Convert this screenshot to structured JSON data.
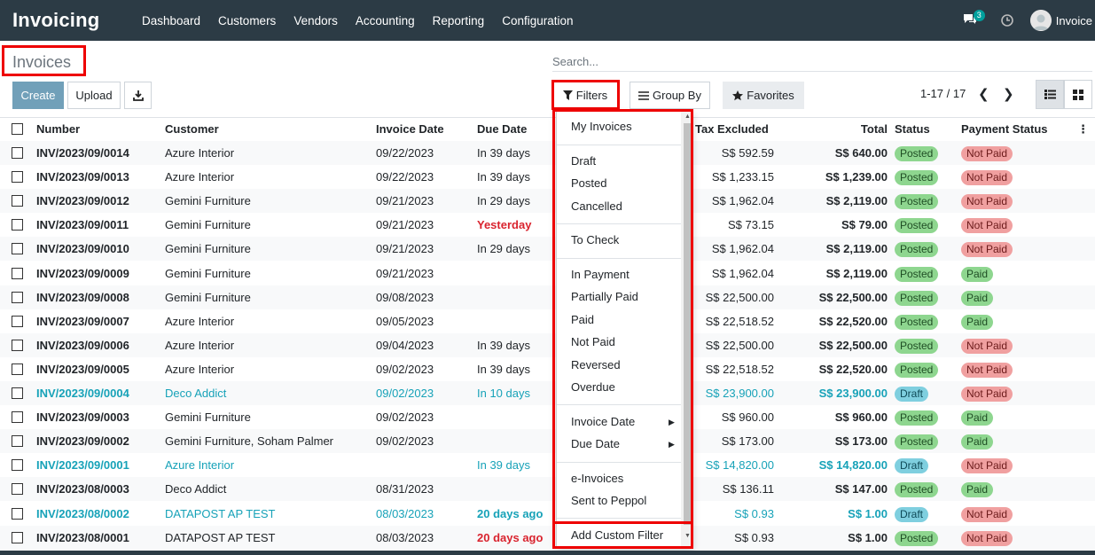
{
  "app": {
    "brand": "Invoicing",
    "user": "Invoice",
    "chat_count": "3"
  },
  "menu": [
    "Dashboard",
    "Customers",
    "Vendors",
    "Accounting",
    "Reporting",
    "Configuration"
  ],
  "page": {
    "title": "Invoices",
    "search_placeholder": "Search...",
    "pager": "1-17 / 17"
  },
  "buttons": {
    "create": "Create",
    "upload": "Upload",
    "filters": "Filters",
    "group_by": "Group By",
    "favorites": "Favorites"
  },
  "columns": {
    "number": "Number",
    "customer": "Customer",
    "invoice_date": "Invoice Date",
    "due_date": "Due Date",
    "tax_excluded": "Tax Excluded",
    "total": "Total",
    "status": "Status",
    "payment_status": "Payment Status"
  },
  "rows": [
    {
      "number": "INV/2023/09/0014",
      "customer": "Azure Interior",
      "invoice_date": "09/22/2023",
      "due_date": "In 39 days",
      "tax_excluded": "S$ 592.59",
      "total": "S$ 640.00",
      "status": "Posted",
      "payment": "Not Paid"
    },
    {
      "number": "INV/2023/09/0013",
      "customer": "Azure Interior",
      "invoice_date": "09/22/2023",
      "due_date": "In 39 days",
      "tax_excluded": "S$ 1,233.15",
      "total": "S$ 1,239.00",
      "status": "Posted",
      "payment": "Not Paid"
    },
    {
      "number": "INV/2023/09/0012",
      "customer": "Gemini Furniture",
      "invoice_date": "09/21/2023",
      "due_date": "In 29 days",
      "tax_excluded": "S$ 1,962.04",
      "total": "S$ 2,119.00",
      "status": "Posted",
      "payment": "Not Paid"
    },
    {
      "number": "INV/2023/09/0011",
      "customer": "Gemini Furniture",
      "invoice_date": "09/21/2023",
      "due_date": "Yesterday",
      "tax_excluded": "S$ 73.15",
      "total": "S$ 79.00",
      "status": "Posted",
      "payment": "Not Paid"
    },
    {
      "number": "INV/2023/09/0010",
      "customer": "Gemini Furniture",
      "invoice_date": "09/21/2023",
      "due_date": "In 29 days",
      "tax_excluded": "S$ 1,962.04",
      "total": "S$ 2,119.00",
      "status": "Posted",
      "payment": "Not Paid"
    },
    {
      "number": "INV/2023/09/0009",
      "customer": "Gemini Furniture",
      "invoice_date": "09/21/2023",
      "due_date": "",
      "tax_excluded": "S$ 1,962.04",
      "total": "S$ 2,119.00",
      "status": "Posted",
      "payment": "Paid"
    },
    {
      "number": "INV/2023/09/0008",
      "customer": "Gemini Furniture",
      "invoice_date": "09/08/2023",
      "due_date": "",
      "tax_excluded": "S$ 22,500.00",
      "total": "S$ 22,500.00",
      "status": "Posted",
      "payment": "Paid"
    },
    {
      "number": "INV/2023/09/0007",
      "customer": "Azure Interior",
      "invoice_date": "09/05/2023",
      "due_date": "",
      "tax_excluded": "S$ 22,518.52",
      "total": "S$ 22,520.00",
      "status": "Posted",
      "payment": "Paid"
    },
    {
      "number": "INV/2023/09/0006",
      "customer": "Azure Interior",
      "invoice_date": "09/04/2023",
      "due_date": "In 39 days",
      "tax_excluded": "S$ 22,500.00",
      "total": "S$ 22,500.00",
      "status": "Posted",
      "payment": "Not Paid"
    },
    {
      "number": "INV/2023/09/0005",
      "customer": "Azure Interior",
      "invoice_date": "09/02/2023",
      "due_date": "In 39 days",
      "tax_excluded": "S$ 22,518.52",
      "total": "S$ 22,520.00",
      "status": "Posted",
      "payment": "Not Paid"
    },
    {
      "number": "INV/2023/09/0004",
      "customer": "Deco Addict",
      "invoice_date": "09/02/2023",
      "due_date": "In 10 days",
      "tax_excluded": "S$ 23,900.00",
      "total": "S$ 23,900.00",
      "status": "Draft",
      "payment": "Not Paid"
    },
    {
      "number": "INV/2023/09/0003",
      "customer": "Gemini Furniture",
      "invoice_date": "09/02/2023",
      "due_date": "",
      "tax_excluded": "S$ 960.00",
      "total": "S$ 960.00",
      "status": "Posted",
      "payment": "Paid"
    },
    {
      "number": "INV/2023/09/0002",
      "customer": "Gemini Furniture, Soham Palmer",
      "invoice_date": "09/02/2023",
      "due_date": "",
      "tax_excluded": "S$ 173.00",
      "total": "S$ 173.00",
      "status": "Posted",
      "payment": "Paid"
    },
    {
      "number": "INV/2023/09/0001",
      "customer": "Azure Interior",
      "invoice_date": "",
      "due_date": "In 39 days",
      "tax_excluded": "S$ 14,820.00",
      "total": "S$ 14,820.00",
      "status": "Draft",
      "payment": "Not Paid"
    },
    {
      "number": "INV/2023/08/0003",
      "customer": "Deco Addict",
      "invoice_date": "08/31/2023",
      "due_date": "",
      "tax_excluded": "S$ 136.11",
      "total": "S$ 147.00",
      "status": "Posted",
      "payment": "Paid"
    },
    {
      "number": "INV/2023/08/0002",
      "customer": "DATAPOST AP TEST",
      "invoice_date": "08/03/2023",
      "due_date": "20 days ago",
      "tax_excluded": "S$ 0.93",
      "total": "S$ 1.00",
      "status": "Draft",
      "payment": "Not Paid"
    },
    {
      "number": "INV/2023/08/0001",
      "customer": "DATAPOST AP TEST",
      "invoice_date": "08/03/2023",
      "due_date": "20 days ago",
      "tax_excluded": "S$ 0.93",
      "total": "S$ 1.00",
      "status": "Posted",
      "payment": "Not Paid"
    }
  ],
  "filters_menu": [
    {
      "label": "My Invoices"
    },
    {
      "label": "Draft"
    },
    {
      "label": "Posted"
    },
    {
      "label": "Cancelled"
    },
    {
      "label": "To Check"
    },
    {
      "label": "In Payment"
    },
    {
      "label": "Partially Paid"
    },
    {
      "label": "Paid"
    },
    {
      "label": "Not Paid"
    },
    {
      "label": "Reversed"
    },
    {
      "label": "Overdue"
    },
    {
      "label": "Invoice Date",
      "submenu": true
    },
    {
      "label": "Due Date",
      "submenu": true
    },
    {
      "label": "e-Invoices"
    },
    {
      "label": "Sent to Peppol"
    },
    {
      "label": "Add Custom Filter"
    }
  ],
  "colors": {
    "navbar": "#2c3b45",
    "accent": "#71a0b9",
    "draft_link": "#17a2b8",
    "overdue": "#d9232e",
    "highlight_box": "#e00000"
  }
}
